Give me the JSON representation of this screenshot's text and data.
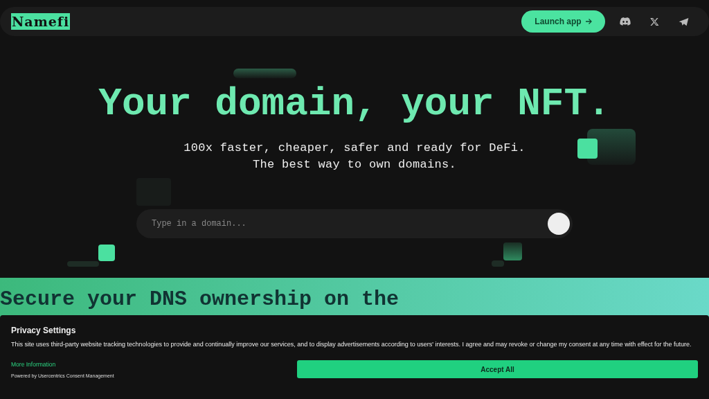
{
  "nav": {
    "logo": "Namefi",
    "launch_button": "Launch app",
    "social_links": [
      {
        "kind": "discord"
      },
      {
        "kind": "x"
      },
      {
        "kind": "telegram"
      }
    ]
  },
  "hero": {
    "title": "Your domain, your NFT.",
    "subtitle_lines": [
      "100x faster, cheaper, safer and ready for DeFi.",
      "The best way to own domains."
    ],
    "search": {
      "placeholder": "Type in a domain..."
    }
  },
  "section": {
    "heading": "Secure your DNS ownership on the"
  },
  "cookie_banner": {
    "title": "Privacy Settings",
    "text": "This site uses third-party website tracking technologies to provide and continually improve our services, and to display advertisements according to users' interests. I agree and may revoke or change my consent at any time with effect for the future.",
    "more_link": "More Information",
    "powered_by": "Powered by Usercentrics Consent Management",
    "accept_button": "Accept All"
  }
}
